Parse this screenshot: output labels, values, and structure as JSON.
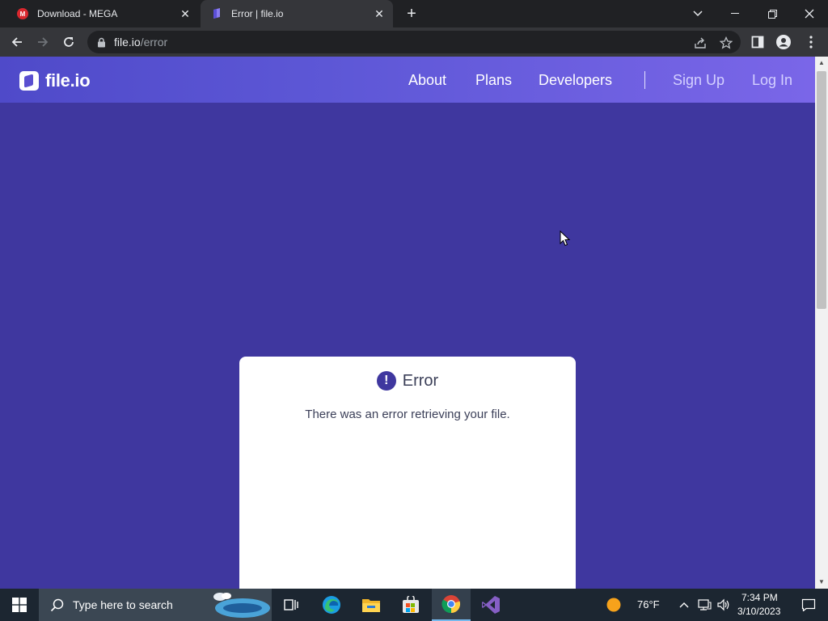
{
  "browser": {
    "tabs": [
      {
        "title": "Download - MEGA",
        "active": false
      },
      {
        "title": "Error | file.io",
        "active": true
      }
    ],
    "url_host": "file.io",
    "url_path": "/error"
  },
  "site": {
    "brand": "file.io",
    "nav": {
      "about": "About",
      "plans": "Plans",
      "developers": "Developers",
      "sign_up": "Sign Up",
      "log_in": "Log In"
    }
  },
  "error_card": {
    "icon": "!",
    "title": "Error",
    "message": "There was an error retrieving your file."
  },
  "taskbar": {
    "search_placeholder": "Type here to search",
    "weather": "76°F",
    "time": "7:34 PM",
    "date": "3/10/2023"
  },
  "colors": {
    "page_bg": "#3f379f",
    "header_gradient_start": "#4f4ac9",
    "header_gradient_end": "#7a66e8",
    "card_bg": "#ffffff"
  },
  "icons": [
    "mega-favicon",
    "fileio-favicon",
    "back-arrow-icon",
    "forward-arrow-icon",
    "reload-icon",
    "lock-icon",
    "share-icon",
    "star-icon",
    "sidepanel-icon",
    "profile-icon",
    "kebab-menu-icon",
    "windows-start-icon",
    "search-icon",
    "task-view-icon",
    "edge-icon",
    "file-explorer-icon",
    "store-icon",
    "chrome-icon",
    "visual-studio-icon",
    "weather-sun-icon",
    "chevron-up-icon",
    "network-icon",
    "volume-icon",
    "notification-icon"
  ]
}
